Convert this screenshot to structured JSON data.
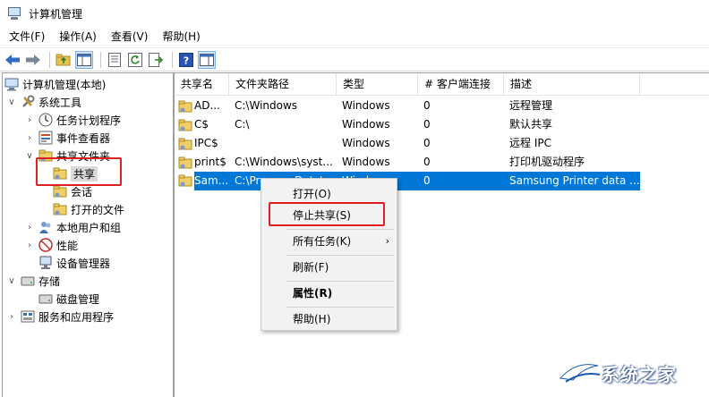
{
  "window": {
    "title": "计算机管理"
  },
  "menubar": [
    "文件(F)",
    "操作(A)",
    "查看(V)",
    "帮助(H)"
  ],
  "toolbar": [
    "back-icon",
    "forward-icon",
    "up-folder-icon",
    "show-hide-tree-icon",
    "properties-icon",
    "refresh-icon",
    "export-list-icon",
    "help-icon",
    "action-pane-icon"
  ],
  "tree": {
    "root": "计算机管理(本地)",
    "system_tools": "系统工具",
    "task_scheduler": "任务计划程序",
    "event_viewer": "事件查看器",
    "shared_folders": "共享文件夹",
    "shares": "共享",
    "sessions": "会话",
    "open_files": "打开的文件",
    "local_users": "本地用户和组",
    "performance": "性能",
    "device_manager": "设备管理器",
    "storage": "存储",
    "disk_management": "磁盘管理",
    "services_apps": "服务和应用程序"
  },
  "list": {
    "columns": [
      "共享名",
      "文件夹路径",
      "类型",
      "# 客户端连接",
      "描述"
    ],
    "rows": [
      {
        "name": "AD...",
        "path": "C:\\Windows",
        "type": "Windows",
        "clients": "0",
        "desc": "远程管理"
      },
      {
        "name": "C$",
        "path": "C:\\",
        "type": "Windows",
        "clients": "0",
        "desc": "默认共享"
      },
      {
        "name": "IPC$",
        "path": "",
        "type": "Windows",
        "clients": "0",
        "desc": "远程 IPC"
      },
      {
        "name": "print$",
        "path": "C:\\Windows\\syst...",
        "type": "Windows",
        "clients": "0",
        "desc": "打印机驱动程序"
      },
      {
        "name": "Sam...",
        "path": "C:\\ProgramData\\...",
        "type": "Windows",
        "clients": "0",
        "desc": "Samsung Printer data ..."
      }
    ]
  },
  "context_menu": {
    "open": "打开(O)",
    "stop_sharing": "停止共享(S)",
    "all_tasks": "所有任务(K)",
    "refresh": "刷新(F)",
    "properties": "属性(R)",
    "help": "帮助(H)"
  },
  "watermark": {
    "text": "系统之家"
  },
  "colors": {
    "selection": "#0078d7",
    "highlight_box": "#e02020"
  }
}
